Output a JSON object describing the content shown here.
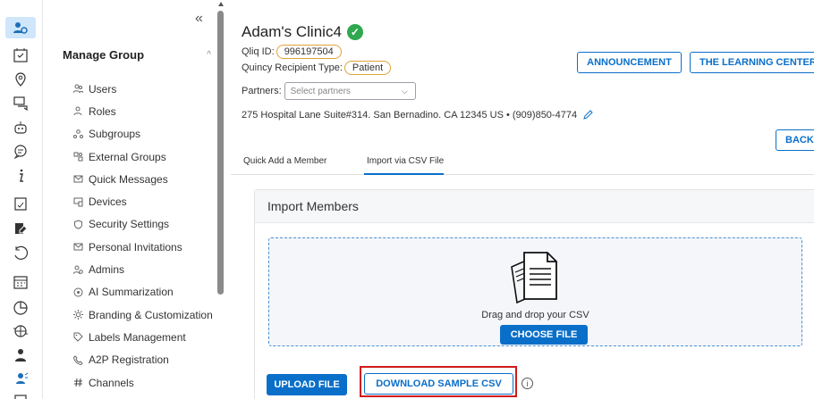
{
  "rail": {
    "icons": [
      "group-admin-icon",
      "checklist-icon",
      "location-pin-icon",
      "chat-icon",
      "bot-icon",
      "message-icon",
      "info-person-icon",
      "clipboard-icon",
      "edit-doc-icon",
      "history-icon",
      "calendar-icon",
      "pie-chart-icon",
      "globe-icon",
      "person-badge-icon",
      "mic-person-icon",
      "card-icon"
    ]
  },
  "sidebar": {
    "collapse_label": "«",
    "group_title": "Manage Group",
    "group_chevron": "^",
    "items": [
      {
        "label": "Users",
        "icon": "users-icon"
      },
      {
        "label": "Roles",
        "icon": "roles-icon"
      },
      {
        "label": "Subgroups",
        "icon": "subgroups-icon"
      },
      {
        "label": "External Groups",
        "icon": "external-groups-icon"
      },
      {
        "label": "Quick Messages",
        "icon": "quick-messages-icon"
      },
      {
        "label": "Devices",
        "icon": "devices-icon"
      },
      {
        "label": "Security Settings",
        "icon": "shield-icon"
      },
      {
        "label": "Personal Invitations",
        "icon": "envelope-icon"
      },
      {
        "label": "Admins",
        "icon": "admins-icon"
      },
      {
        "label": "AI Summarization",
        "icon": "ai-icon"
      },
      {
        "label": "Branding & Customization",
        "icon": "gear-icon"
      },
      {
        "label": "Labels Management",
        "icon": "tag-icon"
      },
      {
        "label": "A2P Registration",
        "icon": "phone-icon"
      },
      {
        "label": "Channels",
        "icon": "hash-icon"
      }
    ]
  },
  "header": {
    "clinic_name": "Adam's Clinic4",
    "verified_icon": "check-circle-icon",
    "qliq_label": "Qliq ID:",
    "qliq_value": "996197504",
    "recipient_label": "Quincy Recipient Type:",
    "recipient_value": "Patient",
    "partners_label": "Partners:",
    "partners_placeholder": "Select partners",
    "address": "275 Hospital Lane Suite#314. San Bernadino. CA 12345 US • (909)850-4774",
    "announcement_label": "ANNOUNCEMENT",
    "learning_label": "THE LEARNING CENTER",
    "back_label": "BACK"
  },
  "tabs": [
    {
      "label": "Quick Add a Member",
      "active": false
    },
    {
      "label": "Import via CSV File",
      "active": true
    }
  ],
  "import_card": {
    "title": "Import Members",
    "drop_text": "Drag and drop your CSV",
    "choose_label": "CHOOSE FILE",
    "upload_label": "UPLOAD FILE",
    "download_label": "DOWNLOAD SAMPLE CSV",
    "info_glyph": "i"
  },
  "colors": {
    "accent": "#0a6fc9",
    "pill_border": "#e0a33a",
    "verified": "#2fa84f",
    "highlight": "#d11a1a",
    "rail_active": "#cfe6fb"
  }
}
